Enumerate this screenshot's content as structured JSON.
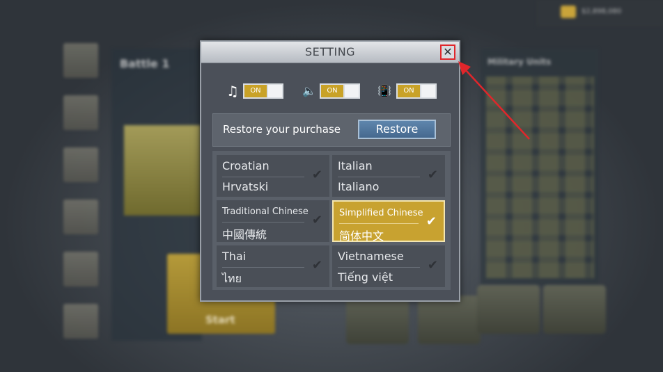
{
  "modal": {
    "title": "SETTING",
    "close_symbol": "✕"
  },
  "toggles": [
    {
      "icon": "music-note-icon",
      "glyph": "♫",
      "state": "ON"
    },
    {
      "icon": "speaker-icon",
      "glyph": "🔈",
      "state": "ON"
    },
    {
      "icon": "vibration-icon",
      "glyph": "📳",
      "state": "ON"
    }
  ],
  "restore": {
    "label": "Restore your purchase",
    "button": "Restore"
  },
  "languages": [
    {
      "english": "Croatian",
      "native": "Hrvatski",
      "selected": false
    },
    {
      "english": "Italian",
      "native": "Italiano",
      "selected": false
    },
    {
      "english": "Traditional Chinese",
      "native": "中國傳統",
      "selected": false
    },
    {
      "english": "Simplified Chinese",
      "native": "简体中文",
      "selected": true
    },
    {
      "english": "Thai",
      "native": "ไทย",
      "selected": false
    },
    {
      "english": "Vietnamese",
      "native": "Tiếng việt",
      "selected": false
    }
  ],
  "check_glyph": "✔",
  "background": {
    "battle_title": "Battle 1",
    "start_label": "Start",
    "military_units_title": "Military Units",
    "gold_amount": "$2,898,080"
  },
  "colors": {
    "accent_gold": "#c8a230",
    "restore_blue": "#4f7399",
    "close_highlight": "#e0262b"
  }
}
